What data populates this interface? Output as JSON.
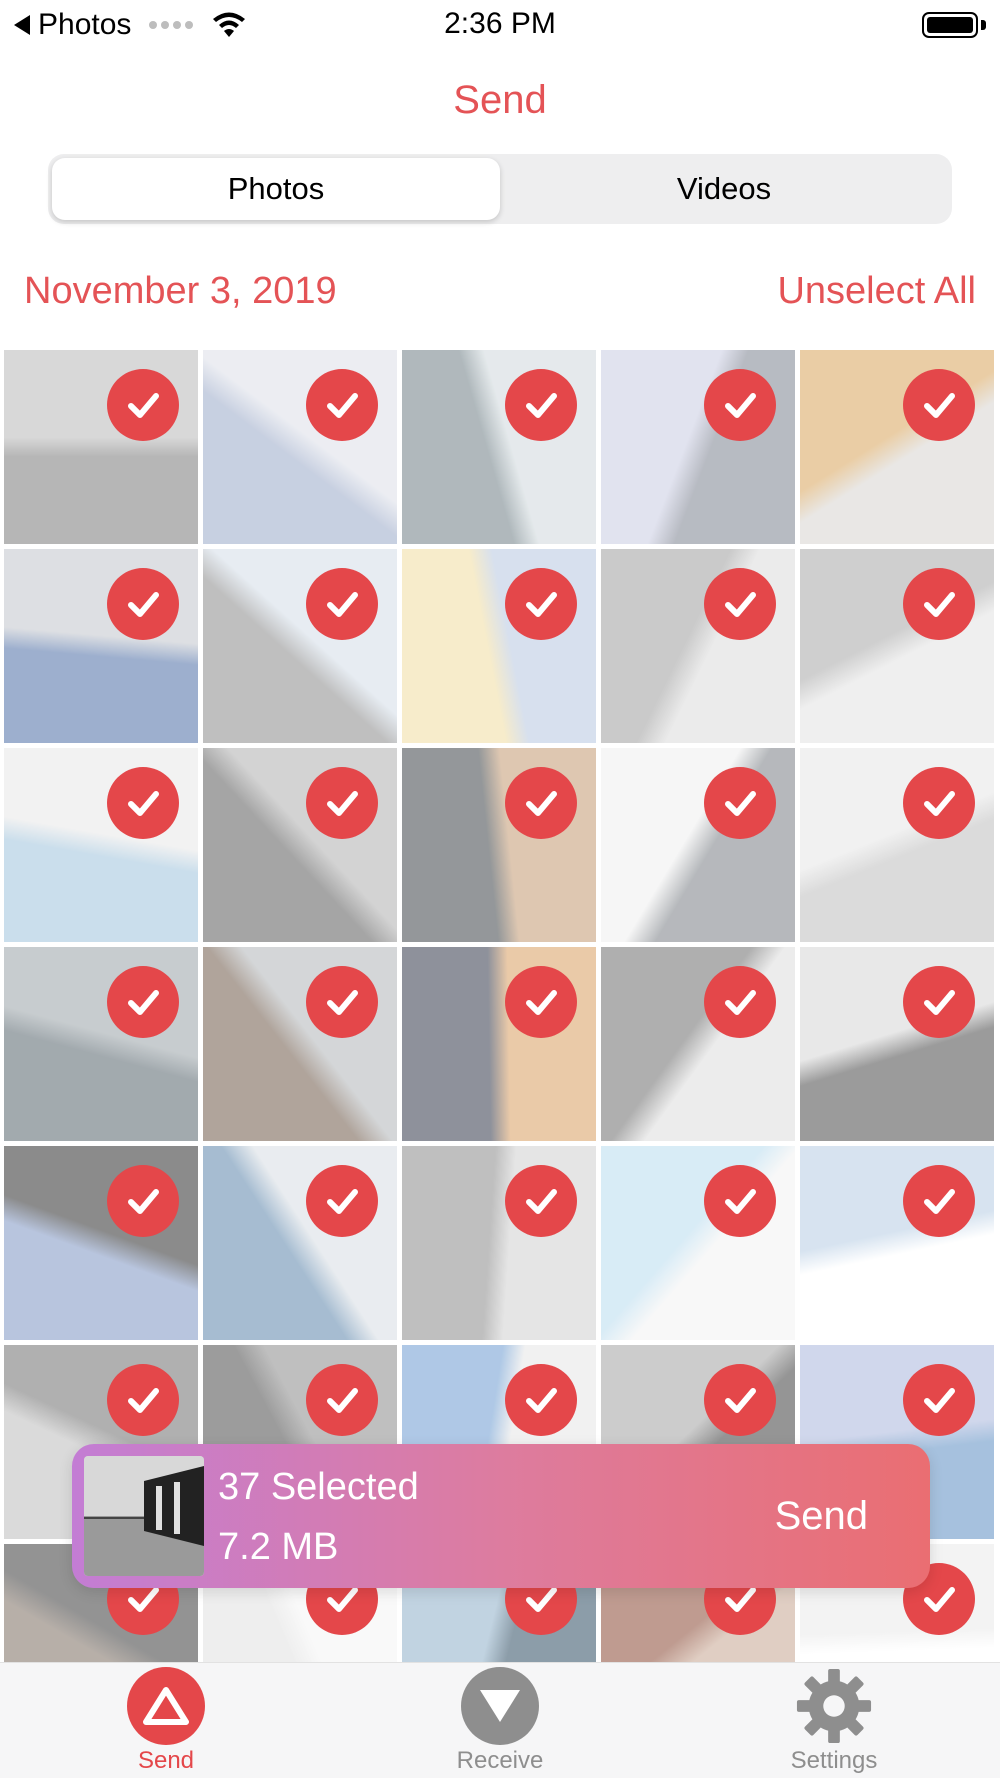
{
  "status_bar": {
    "back_label": "Photos",
    "time": "2:36 PM"
  },
  "header": {
    "title": "Send"
  },
  "segmented": {
    "options": [
      "Photos",
      "Videos"
    ],
    "selected": "Photos"
  },
  "section": {
    "date": "November 3, 2019",
    "unselect_all": "Unselect All"
  },
  "grid": {
    "columns": 5,
    "all_selected": true
  },
  "selection_bar": {
    "count_text": "37 Selected",
    "size_text": "7.2 MB",
    "send_label": "Send"
  },
  "tab_bar": {
    "items": [
      {
        "label": "Send",
        "icon": "up-triangle-icon",
        "active": true
      },
      {
        "label": "Receive",
        "icon": "down-triangle-icon",
        "active": false
      },
      {
        "label": "Settings",
        "icon": "gear-icon",
        "active": false
      }
    ]
  },
  "colors": {
    "accent": "#e45356",
    "check_fill": "#e4474a",
    "bar_gradient_start": "#c37dd4",
    "bar_gradient_end": "#ea6e72",
    "tab_inactive": "#8e8e8e"
  }
}
